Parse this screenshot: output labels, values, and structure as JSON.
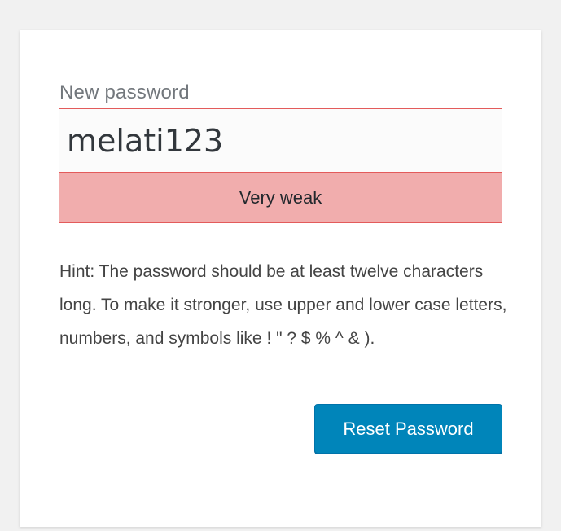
{
  "form": {
    "password_label": "New password",
    "password_value": "melati123",
    "strength_text": "Very weak",
    "hint_text": "Hint: The password should be at least twelve characters long. To make it stronger, use upper and lower case letters, numbers, and symbols like ! \" ? $ % ^ & ).",
    "submit_label": "Reset Password"
  },
  "colors": {
    "page_background": "#f1f1f1",
    "card_background": "#ffffff",
    "strength_background": "#f1adad",
    "strength_border": "#e35b5b",
    "button_background": "#0085ba"
  }
}
